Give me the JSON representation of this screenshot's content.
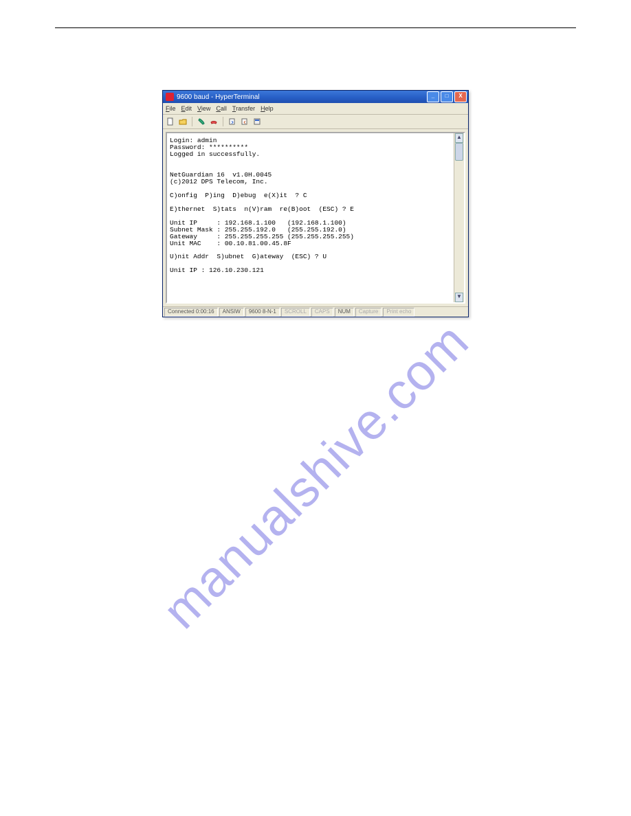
{
  "window": {
    "title": "9600 baud - HyperTerminal",
    "buttons": {
      "min": "_",
      "max": "□",
      "close": "X"
    }
  },
  "menubar": {
    "items": [
      {
        "u": "F",
        "rest": "ile"
      },
      {
        "u": "E",
        "rest": "dit"
      },
      {
        "u": "V",
        "rest": "iew"
      },
      {
        "u": "C",
        "rest": "all"
      },
      {
        "u": "T",
        "rest": "ransfer"
      },
      {
        "u": "H",
        "rest": "elp"
      }
    ]
  },
  "toolbar": {
    "icons": [
      "new-doc-icon",
      "open-icon",
      "separator",
      "call-icon",
      "hangup-icon",
      "separator",
      "send-icon",
      "receive-icon",
      "properties-icon"
    ]
  },
  "terminal_text": "Login: admin\nPassword: **********\nLogged in successfully.\n\n\nNetGuardian 16  v1.0H.0045\n(c)2012 DPS Telecom, Inc.\n\nC)onfig  P)ing  D)ebug  e(X)it  ? C\n\nE)thernet  S)tats  n(V)ram  re(B)oot  (ESC) ? E\n\nUnit IP     : 192.168.1.100   (192.168.1.100)\nSubnet Mask : 255.255.192.0   (255.255.192.0)\nGateway     : 255.255.255.255 (255.255.255.255)\nUnit MAC    : 00.10.81.00.45.8F\n\nU)nit Addr  S)ubnet  G)ateway  (ESC) ? U\n\nUnit IP : 126.10.230.121",
  "statusbar": {
    "conn": "Connected 0:00:16",
    "em": "ANSIW",
    "baud": "9600 8-N-1",
    "scroll": "SCROLL",
    "caps": "CAPS",
    "num": "NUM",
    "capture": "Capture",
    "echo": "Print echo"
  },
  "watermark": "manualshive.com"
}
